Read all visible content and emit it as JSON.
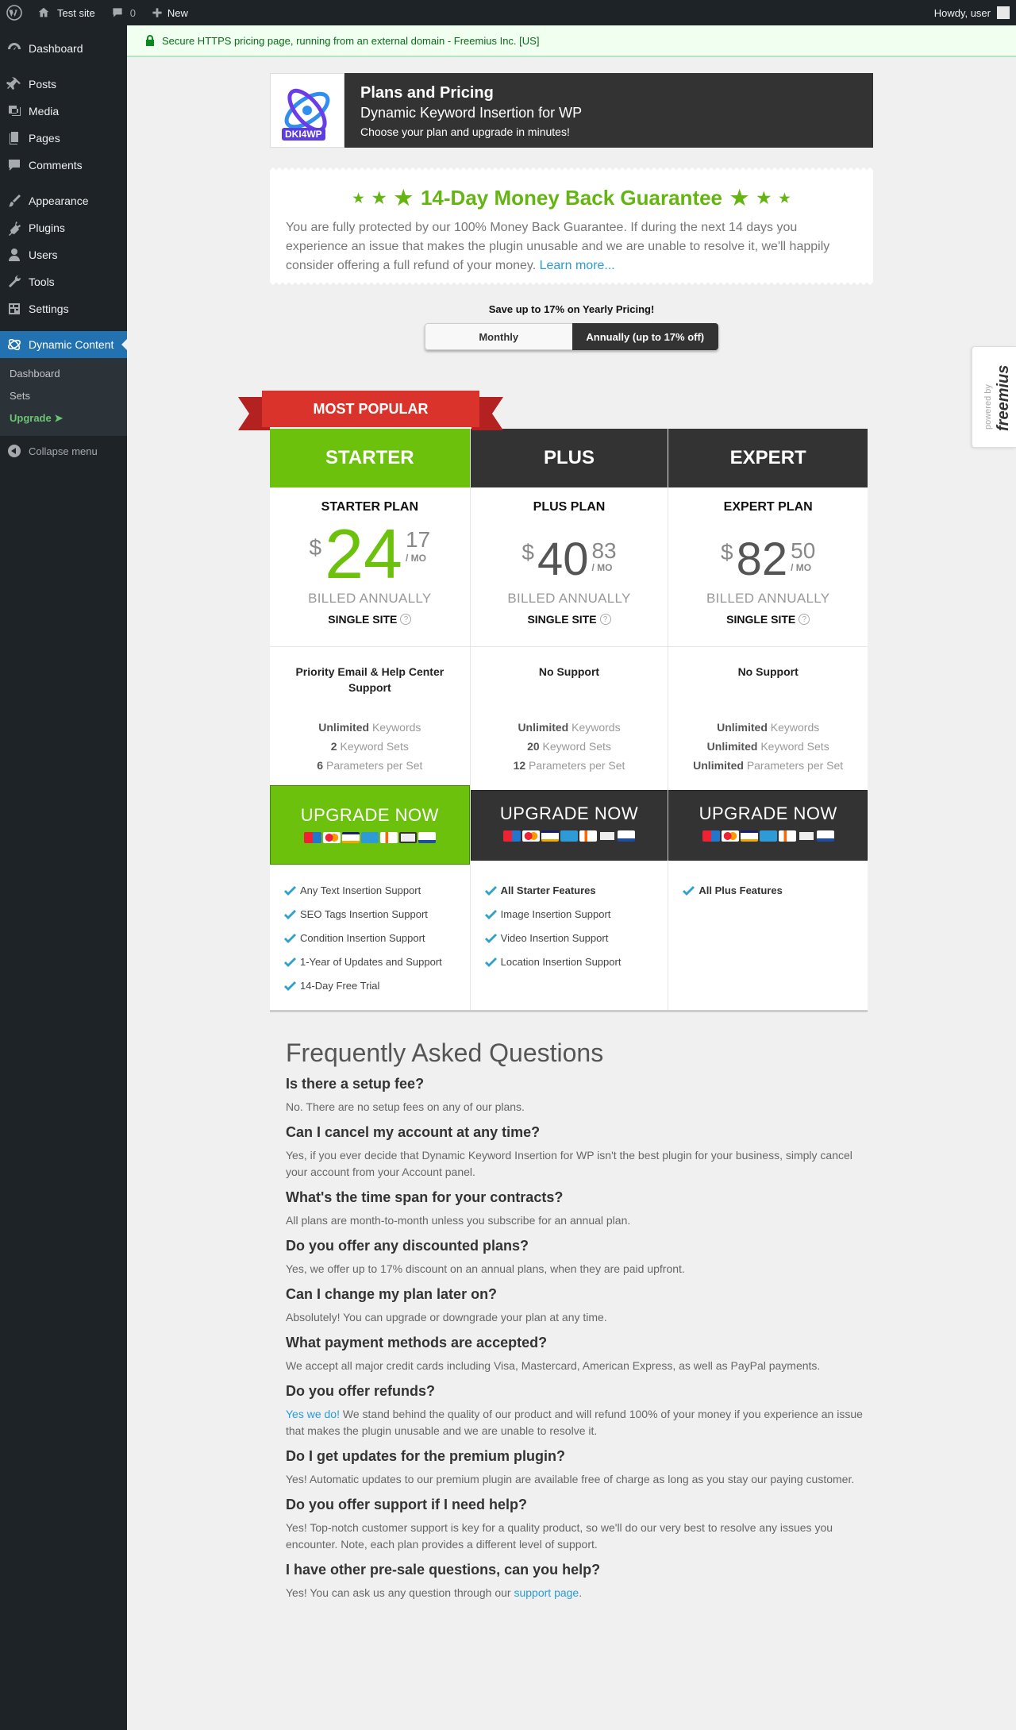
{
  "adminbar": {
    "site_name": "Test site",
    "comments_count": "0",
    "new_label": "New",
    "howdy": "Howdy, user"
  },
  "sidebar": {
    "items": [
      {
        "label": "Dashboard",
        "icon": "dashboard-icon"
      },
      {
        "label": "Posts",
        "icon": "pin-icon"
      },
      {
        "label": "Media",
        "icon": "media-icon"
      },
      {
        "label": "Pages",
        "icon": "pages-icon"
      },
      {
        "label": "Comments",
        "icon": "comment-icon"
      },
      {
        "label": "Appearance",
        "icon": "brush-icon"
      },
      {
        "label": "Plugins",
        "icon": "plug-icon"
      },
      {
        "label": "Users",
        "icon": "user-icon"
      },
      {
        "label": "Tools",
        "icon": "wrench-icon"
      },
      {
        "label": "Settings",
        "icon": "settings-icon"
      },
      {
        "label": "Dynamic Content",
        "icon": "dki-logo-icon"
      }
    ],
    "submenu": [
      {
        "label": "Dashboard"
      },
      {
        "label": "Sets"
      },
      {
        "label": "Upgrade ➤"
      }
    ],
    "collapse": "Collapse menu"
  },
  "secure_notice": "Secure HTTPS pricing page, running from an external domain - Freemius Inc. [US]",
  "header": {
    "logo_text": "DKI4WP",
    "title": "Plans and Pricing",
    "plugin_name": "Dynamic Keyword Insertion for WP",
    "tagline": "Choose your plan and upgrade in minutes!"
  },
  "guarantee": {
    "title": "14-Day Money Back Guarantee",
    "text": "You are fully protected by our 100% Money Back Guarantee. If during the next 14 days you experience an issue that makes the plugin unusable and we are unable to resolve it, we'll happily consider offering a full refund of your money.",
    "link": "Learn more..."
  },
  "billing": {
    "save_text": "Save up to 17% on Yearly Pricing!",
    "monthly": "Monthly",
    "annual": "Annually (up to 17% off)"
  },
  "ribbon": "MOST POPULAR",
  "plans": [
    {
      "header": "STARTER",
      "name": "STARTER PLAN",
      "currency": "$",
      "amount": "24",
      "cents": "17",
      "per": "/ MO",
      "billed": "BILLED ANNUALLY",
      "sites": "SINGLE SITE",
      "support": "Priority Email & Help Center Support",
      "limits": [
        {
          "value": "Unlimited",
          "label": "Keywords"
        },
        {
          "value": "2",
          "label": "Keyword Sets"
        },
        {
          "value": "6",
          "label": "Parameters per Set"
        }
      ],
      "cta": "UPGRADE NOW",
      "features": [
        "Any Text Insertion Support",
        "SEO Tags Insertion Support",
        "Condition Insertion Support",
        "1-Year of Updates and Support",
        "14-Day Free Trial"
      ]
    },
    {
      "header": "PLUS",
      "name": "PLUS PLAN",
      "currency": "$",
      "amount": "40",
      "cents": "83",
      "per": "/ MO",
      "billed": "BILLED ANNUALLY",
      "sites": "SINGLE SITE",
      "support": "No Support",
      "limits": [
        {
          "value": "Unlimited",
          "label": "Keywords"
        },
        {
          "value": "20",
          "label": "Keyword Sets"
        },
        {
          "value": "12",
          "label": "Parameters per Set"
        }
      ],
      "cta": "UPGRADE NOW",
      "features": [
        "All Starter Features",
        "Image Insertion Support",
        "Video Insertion Support",
        "Location Insertion Support"
      ]
    },
    {
      "header": "EXPERT",
      "name": "EXPERT PLAN",
      "currency": "$",
      "amount": "82",
      "cents": "50",
      "per": "/ MO",
      "billed": "BILLED ANNUALLY",
      "sites": "SINGLE SITE",
      "support": "No Support",
      "limits": [
        {
          "value": "Unlimited",
          "label": "Keywords"
        },
        {
          "value": "Unlimited",
          "label": "Keyword Sets"
        },
        {
          "value": "Unlimited",
          "label": "Parameters per Set"
        }
      ],
      "cta": "UPGRADE NOW",
      "features": [
        "All Plus Features"
      ]
    }
  ],
  "freemius": {
    "powered_by": "powered by",
    "brand": "freemius"
  },
  "faq": {
    "title": "Frequently Asked Questions",
    "items": [
      {
        "q": "Is there a setup fee?",
        "a": "No. There are no setup fees on any of our plans."
      },
      {
        "q": "Can I cancel my account at any time?",
        "a": "Yes, if you ever decide that Dynamic Keyword Insertion for WP isn't the best plugin for your business, simply cancel your account from your Account panel."
      },
      {
        "q": "What's the time span for your contracts?",
        "a": "All plans are month-to-month unless you subscribe for an annual plan."
      },
      {
        "q": "Do you offer any discounted plans?",
        "a": "Yes, we offer up to 17% discount on an annual plans, when they are paid upfront."
      },
      {
        "q": "Can I change my plan later on?",
        "a": "Absolutely! You can upgrade or downgrade your plan at any time."
      },
      {
        "q": "What payment methods are accepted?",
        "a": "We accept all major credit cards including Visa, Mastercard, American Express, as well as PayPal payments."
      },
      {
        "q": "Do you offer refunds?",
        "a_link": "Yes we do!",
        "a": "We stand behind the quality of our product and will refund 100% of your money if you experience an issue that makes the plugin unusable and we are unable to resolve it."
      },
      {
        "q": "Do I get updates for the premium plugin?",
        "a": "Yes! Automatic updates to our premium plugin are available free of charge as long as you stay our paying customer."
      },
      {
        "q": "Do you offer support if I need help?",
        "a": "Yes! Top-notch customer support is key for a quality product, so we'll do our very best to resolve any issues you encounter. Note, each plan provides a different level of support."
      },
      {
        "q": "I have other pre-sale questions, can you help?",
        "a": "Yes! You can ask us any question through our",
        "a_link_after": "support page",
        "a_end": "."
      }
    ]
  }
}
